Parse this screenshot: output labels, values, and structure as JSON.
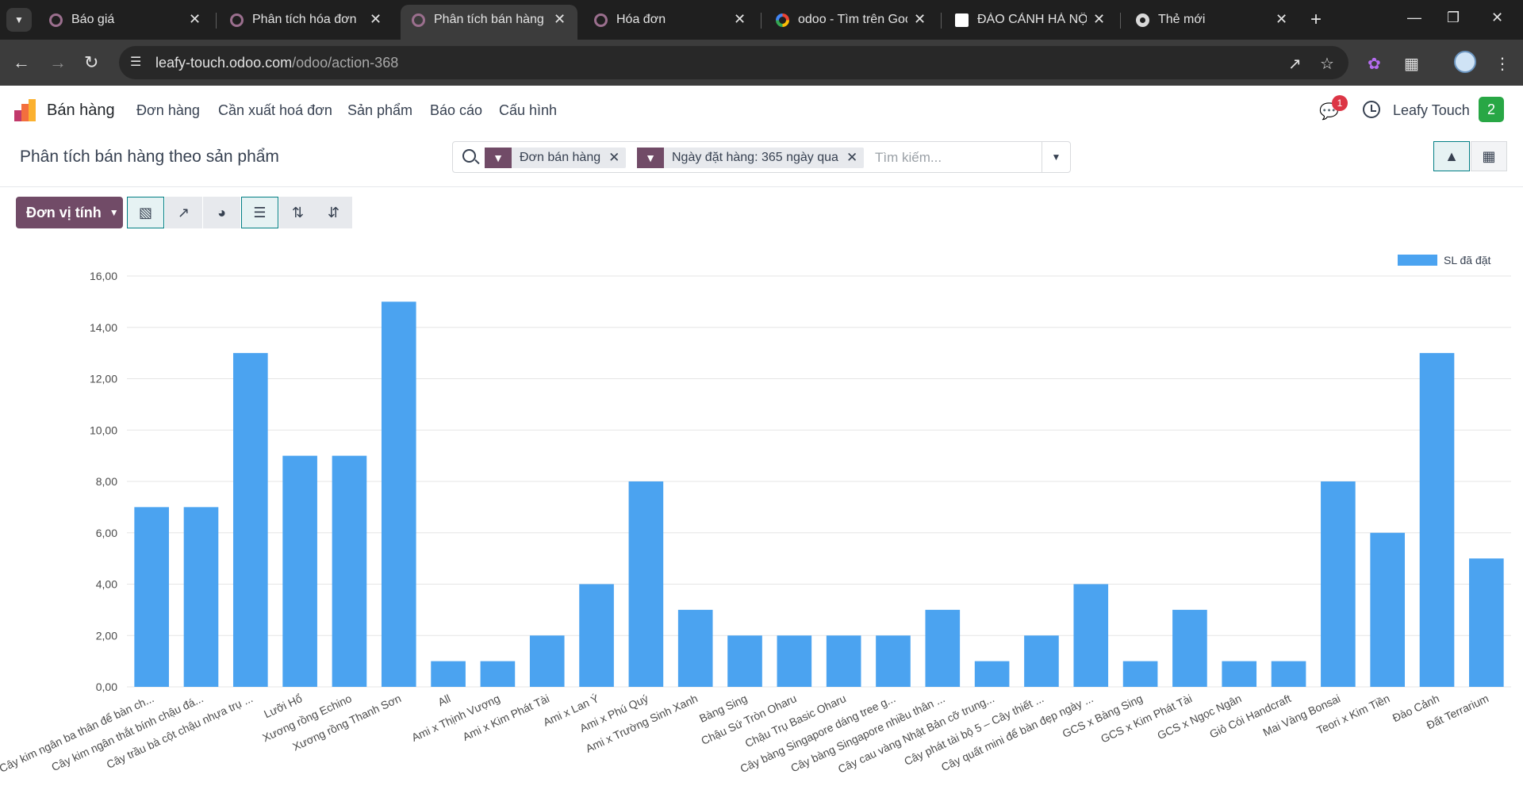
{
  "browser": {
    "tabs": [
      {
        "label": "Báo giá",
        "favicon": "odoo-icon",
        "active": false
      },
      {
        "label": "Phân tích hóa đơn",
        "favicon": "odoo-icon",
        "active": false
      },
      {
        "label": "Phân tích bán hàng t",
        "favicon": "odoo-icon",
        "active": true
      },
      {
        "label": "Hóa đơn",
        "favicon": "odoo-icon",
        "active": false
      },
      {
        "label": "odoo - Tìm trên Goo",
        "favicon": "google-icon",
        "active": false
      },
      {
        "label": "ĐÀO CẢNH HÀ NỘI",
        "favicon": "document-icon",
        "active": false
      },
      {
        "label": "Thẻ mới",
        "favicon": "chrome-icon",
        "active": false
      }
    ],
    "url_host": "leafy-touch.odoo.com",
    "url_path": "/odoo/action-368"
  },
  "odoo": {
    "app_name": "Bán hàng",
    "menus": [
      "Đơn hàng",
      "Cần xuất hoá đơn",
      "Sản phẩm",
      "Báo cáo",
      "Cấu hình"
    ],
    "chat_badge": "1",
    "user_name": "Leafy Touch",
    "company_badge": "2",
    "accent": "#714b67"
  },
  "control_panel": {
    "breadcrumb": "Phân tích bán hàng theo sản phẩm",
    "facets": [
      "Đơn bán hàng",
      "Ngày đặt hàng: 365 ngày qua"
    ],
    "search_placeholder": "Tìm kiếm..."
  },
  "toolbar": {
    "measure_label": "Đơn vị tính"
  },
  "chart_data": {
    "type": "bar",
    "ylim": [
      0,
      16
    ],
    "yticks": [
      "0,00",
      "2,00",
      "4,00",
      "6,00",
      "8,00",
      "10,00",
      "12,00",
      "14,00",
      "16,00"
    ],
    "grid": true,
    "legend_position": "top-right",
    "categories": [
      "Cây kim ngân ba thân để bàn ch...",
      "Cây kim ngân thắt bính chậu đá...",
      "Cây trầu bà cột chậu nhựa trụ ...",
      "Lưỡi Hổ",
      "Xương rồng Echino",
      "Xương rồng Thanh Sơn",
      "All",
      "Ami x Thịnh Vượng",
      "Ami x Kim Phát Tài",
      "Ami x Lan Ý",
      "Ami x Phú Quý",
      "Ami x Trường Sinh Xanh",
      "Bàng Sing",
      "Chậu Sứ Tròn Oharu",
      "Chậu Trụ Basic Oharu",
      "Cây bàng Singapore dáng tree g...",
      "Cây bàng Singapore nhiều thân ...",
      "Cây cau vàng Nhật Bản cỡ trung...",
      "Cây phát tài bộ 5 – Cây thiết ...",
      "Cây quất mini để bàn đẹp ngày ...",
      "GCS x Bàng Sing",
      "GCS x Kim Phát Tài",
      "GCS x Ngọc Ngân",
      "Giỏ Cói Handcraft",
      "Mai Vàng Bonsai",
      "Teori x Kim Tiền",
      "Đào Cảnh",
      "Đất Terrarium"
    ],
    "series": [
      {
        "name": "SL đã đặt",
        "color": "#4ba3f0",
        "values": [
          7,
          7,
          13,
          9,
          9,
          15,
          1,
          1,
          2,
          4,
          8,
          3,
          2,
          2,
          2,
          2,
          3,
          1,
          2,
          4,
          1,
          3,
          1,
          1,
          8,
          6,
          13,
          5
        ]
      }
    ]
  }
}
